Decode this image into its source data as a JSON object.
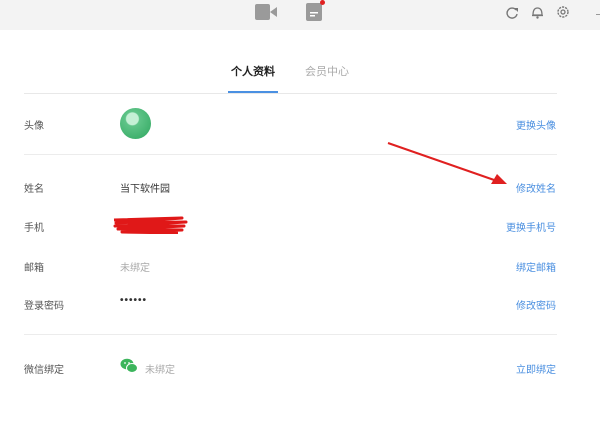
{
  "tabs": {
    "profile": "个人资料",
    "member": "会员中心"
  },
  "rows": {
    "avatar": {
      "label": "头像",
      "action": "更换头像"
    },
    "name": {
      "label": "姓名",
      "value": "当下软件园",
      "action": "修改姓名"
    },
    "phone": {
      "label": "手机",
      "action": "更换手机号"
    },
    "email": {
      "label": "邮箱",
      "value": "未绑定",
      "action": "绑定邮箱"
    },
    "password": {
      "label": "登录密码",
      "value": "••••••",
      "action": "修改密码"
    },
    "wechat": {
      "label": "微信绑定",
      "value": "未绑定",
      "action": "立即绑定"
    }
  },
  "colors": {
    "accent": "#4a8fe0",
    "annotation": "#e02020"
  },
  "icons": [
    "video-icon",
    "document-icon",
    "sync-icon",
    "bell-icon",
    "gear-icon",
    "wechat-icon"
  ]
}
